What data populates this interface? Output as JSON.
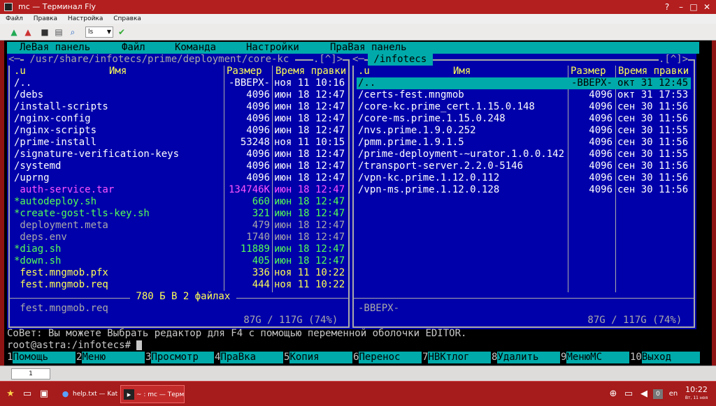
{
  "window": {
    "title": "mc — Терминал Fly",
    "menu": [
      "Файл",
      "Правка",
      "Настройка",
      "Справка"
    ],
    "combo_value": "ls",
    "tab_label": "1"
  },
  "mc": {
    "menu": [
      "ЛеВая панель",
      "Файл",
      "Команда",
      "Настройки",
      "ПраВая панель"
    ],
    "left": {
      "path": " /usr/share/infotecs/prime/deployment/core-kc ",
      "corner": ".[^]>",
      "headers": {
        "u": ".u",
        "name": "Имя",
        "size": "Размер",
        "time": "Время правки"
      },
      "rows": [
        {
          "name": "/..",
          "size": "-ВВЕРХ-",
          "time": "ноя 11 10:16",
          "color": "#ffffff"
        },
        {
          "name": "/debs",
          "size": "4096",
          "time": "июн 18 12:47",
          "color": "#ffffff"
        },
        {
          "name": "/install-scripts",
          "size": "4096",
          "time": "июн 18 12:47",
          "color": "#ffffff"
        },
        {
          "name": "/nginx-config",
          "size": "4096",
          "time": "июн 18 12:47",
          "color": "#ffffff"
        },
        {
          "name": "/nginx-scripts",
          "size": "4096",
          "time": "июн 18 12:47",
          "color": "#ffffff"
        },
        {
          "name": "/prime-install",
          "size": "53248",
          "time": "ноя 11 10:15",
          "color": "#ffffff"
        },
        {
          "name": "/signature-verification-keys",
          "size": "4096",
          "time": "июн 18 12:47",
          "color": "#ffffff"
        },
        {
          "name": "/systemd",
          "size": "4096",
          "time": "июн 18 12:47",
          "color": "#ffffff"
        },
        {
          "name": "/uprng",
          "size": "4096",
          "time": "июн 18 12:47",
          "color": "#ffffff"
        },
        {
          "name": " auth-service.tar",
          "size": "134746K",
          "time": "июн 18 12:47",
          "color": "#ff55ff"
        },
        {
          "name": "*autodeploy.sh",
          "size": "660",
          "time": "июн 18 12:47",
          "color": "#55ff55"
        },
        {
          "name": "*create-gost-tls-key.sh",
          "size": "321",
          "time": "июн 18 12:47",
          "color": "#55ff55"
        },
        {
          "name": " deployment.meta",
          "size": "479",
          "time": "июн 18 12:47",
          "color": "#aaaaaa"
        },
        {
          "name": " deps.env",
          "size": "1740",
          "time": "июн 18 12:47",
          "color": "#aaaaaa"
        },
        {
          "name": "*diag.sh",
          "size": "11889",
          "time": "июн 18 12:47",
          "color": "#55ff55"
        },
        {
          "name": "*down.sh",
          "size": "405",
          "time": "июн 18 12:47",
          "color": "#55ff55"
        },
        {
          "name": " fest.mngmob.pfx",
          "size": "336",
          "time": "ноя 11 10:22",
          "color": "#ffff55"
        },
        {
          "name": " fest.mngmob.req",
          "size": "444",
          "time": "ноя 11 10:22",
          "color": "#ffff55"
        }
      ],
      "selection_summary": " 780 Б В 2 файлах ",
      "status_name": " fest.mngmob.req",
      "disk": " 87G / 117G (74%) "
    },
    "right": {
      "path": " /infotecs ",
      "corner": ".[^]>",
      "headers": {
        "u": ".u",
        "name": "Имя",
        "size": "Размер",
        "time": "Время правки"
      },
      "rows": [
        {
          "name": "/..",
          "size": "-ВВЕРХ-",
          "time": "окт 31 12:45",
          "color": "#000000"
        },
        {
          "name": "/certs-fest.mngmob",
          "size": "4096",
          "time": "окт 31 17:53",
          "color": "#ffffff"
        },
        {
          "name": "/core-kc.prime_cert.1.15.0.148",
          "size": "4096",
          "time": "сен 30 11:56",
          "color": "#ffffff"
        },
        {
          "name": "/core-ms.prime.1.15.0.248",
          "size": "4096",
          "time": "сен 30 11:56",
          "color": "#ffffff"
        },
        {
          "name": "/nvs.prime.1.9.0.252",
          "size": "4096",
          "time": "сен 30 11:55",
          "color": "#ffffff"
        },
        {
          "name": "/pmm.prime.1.9.1.5",
          "size": "4096",
          "time": "сен 30 11:56",
          "color": "#ffffff"
        },
        {
          "name": "/prime-deployment-~urator.1.0.0.142",
          "size": "4096",
          "time": "сен 30 11:55",
          "color": "#ffffff"
        },
        {
          "name": "/transport-server.2.2.0-5146",
          "size": "4096",
          "time": "сен 30 11:56",
          "color": "#ffffff"
        },
        {
          "name": "/vpn-kc.prime.1.12.0.112",
          "size": "4096",
          "time": "сен 30 11:56",
          "color": "#ffffff"
        },
        {
          "name": "/vpn-ms.prime.1.12.0.128",
          "size": "4096",
          "time": "сен 30 11:56",
          "color": "#ffffff"
        }
      ],
      "status_name": "-ВВЕРХ-",
      "disk": " 87G / 117G (74%) "
    },
    "hint": "СоВет: Вы можете Выбрать редактор для F4 с помощью переменной оболочки EDITOR.",
    "prompt": "root@astra:/infotecs# ",
    "fkeys": [
      {
        "num": "1",
        "label": "Помощь"
      },
      {
        "num": "2",
        "label": "Меню"
      },
      {
        "num": "3",
        "label": "Просмотр"
      },
      {
        "num": "4",
        "label": "ПраВка"
      },
      {
        "num": "5",
        "label": "Копия"
      },
      {
        "num": "6",
        "label": "Перенос"
      },
      {
        "num": "7",
        "label": "НВКтлог"
      },
      {
        "num": "8",
        "label": "Удалить"
      },
      {
        "num": "9",
        "label": "МенюМС"
      },
      {
        "num": "10",
        "label": "Выход"
      }
    ]
  },
  "taskbar": {
    "tasks": [
      {
        "label": "help.txt — Kate"
      },
      {
        "label": "~ : mc — Термина..."
      }
    ],
    "badge": "0",
    "lang": "en",
    "time": "10:22",
    "date": "Вт, 11 ноя"
  },
  "colors": {
    "panel_bg": "#0000aa",
    "cyan": "#00aaaa",
    "header": "#ffff55",
    "frame": "#aaaaaa"
  }
}
